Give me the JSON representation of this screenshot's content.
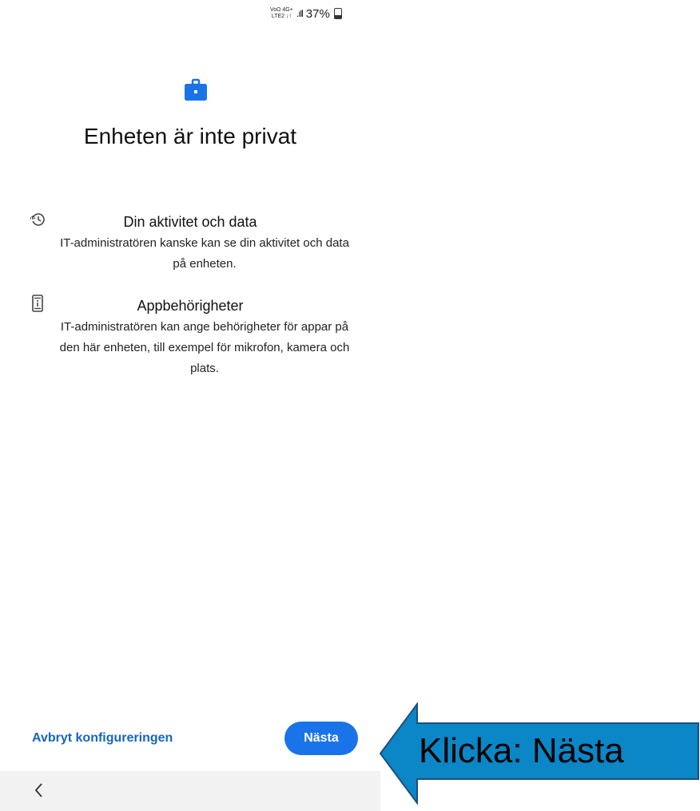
{
  "status_bar": {
    "network_top": "VoΩ 4G+",
    "network_bottom": "LTE2 ↓↑",
    "battery_percent": "37%",
    "signal_icon": "signal-bars-icon",
    "battery_icon": "battery-icon"
  },
  "header": {
    "icon": "briefcase-icon",
    "title": "Enheten är inte privat"
  },
  "items": [
    {
      "icon": "history-icon",
      "heading": "Din aktivitet och data",
      "body": "IT-administratören kanske kan se din aktivitet och data på enheten."
    },
    {
      "icon": "device-info-icon",
      "heading": "Appbehörigheter",
      "body": "IT-administratören kan ange behörigheter för appar på den här enheten, till exempel för mikrofon, kamera och plats."
    }
  ],
  "footer": {
    "cancel_label": "Avbryt konfigureringen",
    "next_label": "Nästa"
  },
  "navbar": {
    "back_icon": "chevron-left-icon"
  },
  "callout": {
    "label": "Klicka: Nästa"
  },
  "colors": {
    "accent": "#1a73e8",
    "link": "#1565c0",
    "callout_fill": "#0b86c6",
    "callout_stroke": "#1f4f7a"
  }
}
